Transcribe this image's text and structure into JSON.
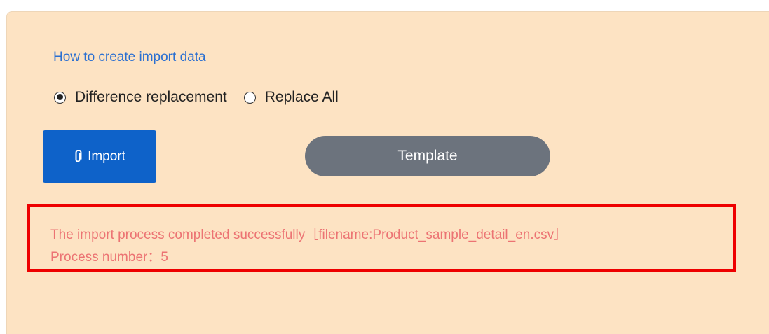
{
  "import_section": {
    "howto_link": "How to create import data",
    "mode_options": [
      {
        "label": "Difference replacement",
        "checked": true
      },
      {
        "label": "Replace All",
        "checked": false
      }
    ],
    "import_button": {
      "label": "Import",
      "icon": "paperclip-icon"
    },
    "template_button": {
      "label": "Template"
    }
  },
  "result_message": {
    "line1": "The import process completed successfully［filename:Product_sample_detail_en.csv］",
    "line2": "Process number：5"
  },
  "colors": {
    "panel_bg": "#fde3c3",
    "link": "#2a6fd1",
    "import_button": "#0e62c9",
    "template_button": "#6c737d",
    "message_text": "#ec7373",
    "highlight_border": "#ee0000"
  }
}
